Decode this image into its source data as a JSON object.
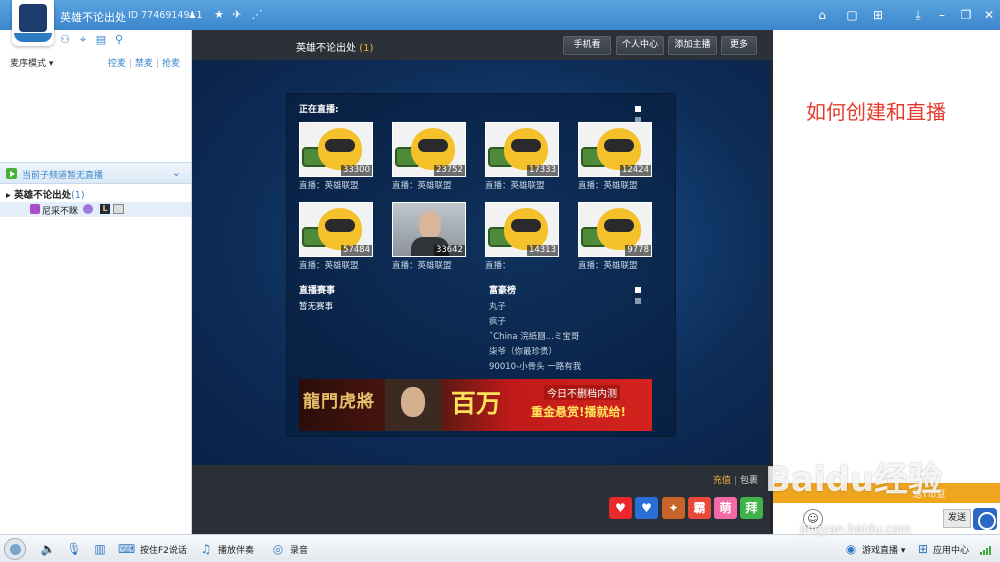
{
  "topbar": {
    "title": "英雄不论出处",
    "id_text": "ID 77469149",
    "user_count": "1"
  },
  "left": {
    "mode_label": "麦序模式",
    "mode_options": [
      "控麦",
      "禁麦",
      "抢麦"
    ],
    "channel_status": "当前子频道暂无直播",
    "tree_root": "英雄不论出处",
    "tree_root_count": "(1)",
    "tree_user": "尼采不眯",
    "tree_user_badge": "L"
  },
  "center": {
    "title": "英雄不论出处",
    "title_count": "(1)",
    "buttons": [
      "手机看",
      "个人中心",
      "添加主播",
      "更多"
    ],
    "live_label": "正在直播:",
    "streams": [
      {
        "count": "33300",
        "caption": "直播：英雄联盟",
        "face": false
      },
      {
        "count": "23752",
        "caption": "直播：英雄联盟",
        "face": false
      },
      {
        "count": "17333",
        "caption": "直播：英雄联盟",
        "face": false
      },
      {
        "count": "12424",
        "caption": "直播：英雄联盟",
        "face": false
      },
      {
        "count": "57484",
        "caption": "直播：英雄联盟",
        "face": false
      },
      {
        "count": "33642",
        "caption": "直播：英雄联盟",
        "face": true
      },
      {
        "count": "14313",
        "caption": "直播：",
        "face": false
      },
      {
        "count": "9778",
        "caption": "直播：英雄联盟",
        "face": false
      }
    ],
    "events_label": "直播赛事",
    "events_empty": "暂无赛事",
    "rich_label": "富豪榜",
    "rich_list": [
      "丸子",
      "疯子",
      "ˇChina 浣纸圝...ミ宝哥",
      "柒爷（你最珍贵）",
      "90010-小骨头 一路有我"
    ],
    "banner": {
      "logo": "龍門虎將",
      "big": "百万",
      "small1": "今日不删档内测",
      "small2": "重金悬赏!播就给!"
    },
    "recharge": "充值",
    "baoxiang": "包裹",
    "gifts": [
      {
        "label": "♥",
        "color": "#e8282b"
      },
      {
        "label": "♥",
        "color": "#2a6fd6"
      },
      {
        "label": "✦",
        "color": "#c8642a"
      },
      {
        "label": "霸",
        "color": "#e84a3a"
      },
      {
        "label": "萌",
        "color": "#f26aa6"
      },
      {
        "label": "拜",
        "color": "#3fb24a"
      }
    ]
  },
  "right": {
    "heading": "如何创建和直播",
    "orange_text": "送Y币豆",
    "send": "发送"
  },
  "watermark": {
    "brand": "Baidu经验",
    "url": "jingyan.baidu.com"
  },
  "statusbar": {
    "ptt": "按住F2说话",
    "music": "播放伴奏",
    "record": "录音",
    "game_live": "游戏直播",
    "app_center": "应用中心"
  },
  "colors": {
    "accent": "#3b86cc",
    "heading_red": "#e53a2a",
    "count_orange": "#f3b33d"
  }
}
